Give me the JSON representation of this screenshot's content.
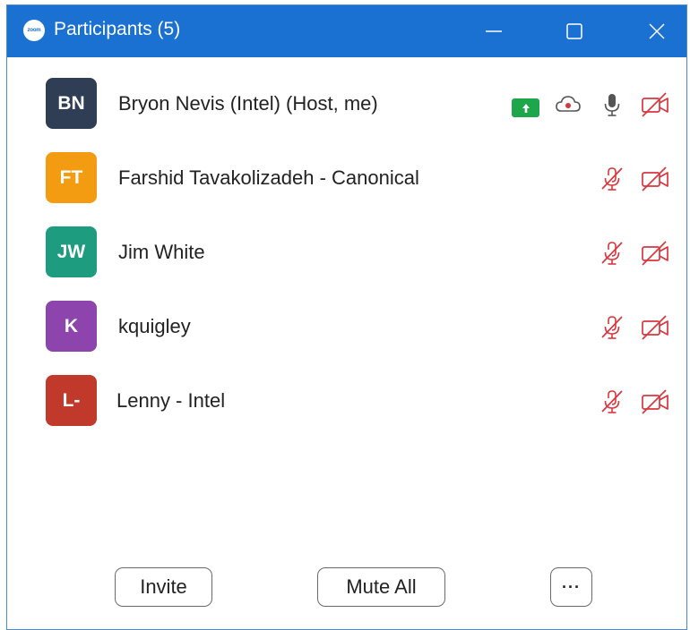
{
  "window": {
    "title": "Participants (5)",
    "logo_text": "zoom",
    "accent_color": "#1a71d1"
  },
  "participants": [
    {
      "initials": "BN",
      "name": "Bryon Nevis (Intel) (Host, me)",
      "avatar_color": "#2f3e55",
      "audio": "unmuted",
      "video": "off",
      "sharing": true,
      "recording": true
    },
    {
      "initials": "FT",
      "name": "Farshid Tavakolizadeh - Canonical",
      "avatar_color": "#f39c12",
      "audio": "muted",
      "video": "off"
    },
    {
      "initials": "JW",
      "name": "Jim White",
      "avatar_color": "#1e9c7f",
      "audio": "muted",
      "video": "off"
    },
    {
      "initials": "K",
      "name": "kquigley",
      "avatar_color": "#8e44ad",
      "audio": "muted",
      "video": "off"
    },
    {
      "initials": "L-",
      "name": "Lenny - Intel",
      "avatar_color": "#c0392b",
      "audio": "muted",
      "video": "off"
    }
  ],
  "footer": {
    "invite_label": "Invite",
    "mute_all_label": "Mute All",
    "more_label": "···"
  },
  "icons": {
    "share": "share-screen-icon",
    "record": "cloud-record-icon",
    "mic": "microphone-icon",
    "mic_muted": "microphone-muted-icon",
    "video_off": "video-off-icon"
  },
  "status_colors": {
    "muted": "#d9363e",
    "share": "#1da64a"
  }
}
